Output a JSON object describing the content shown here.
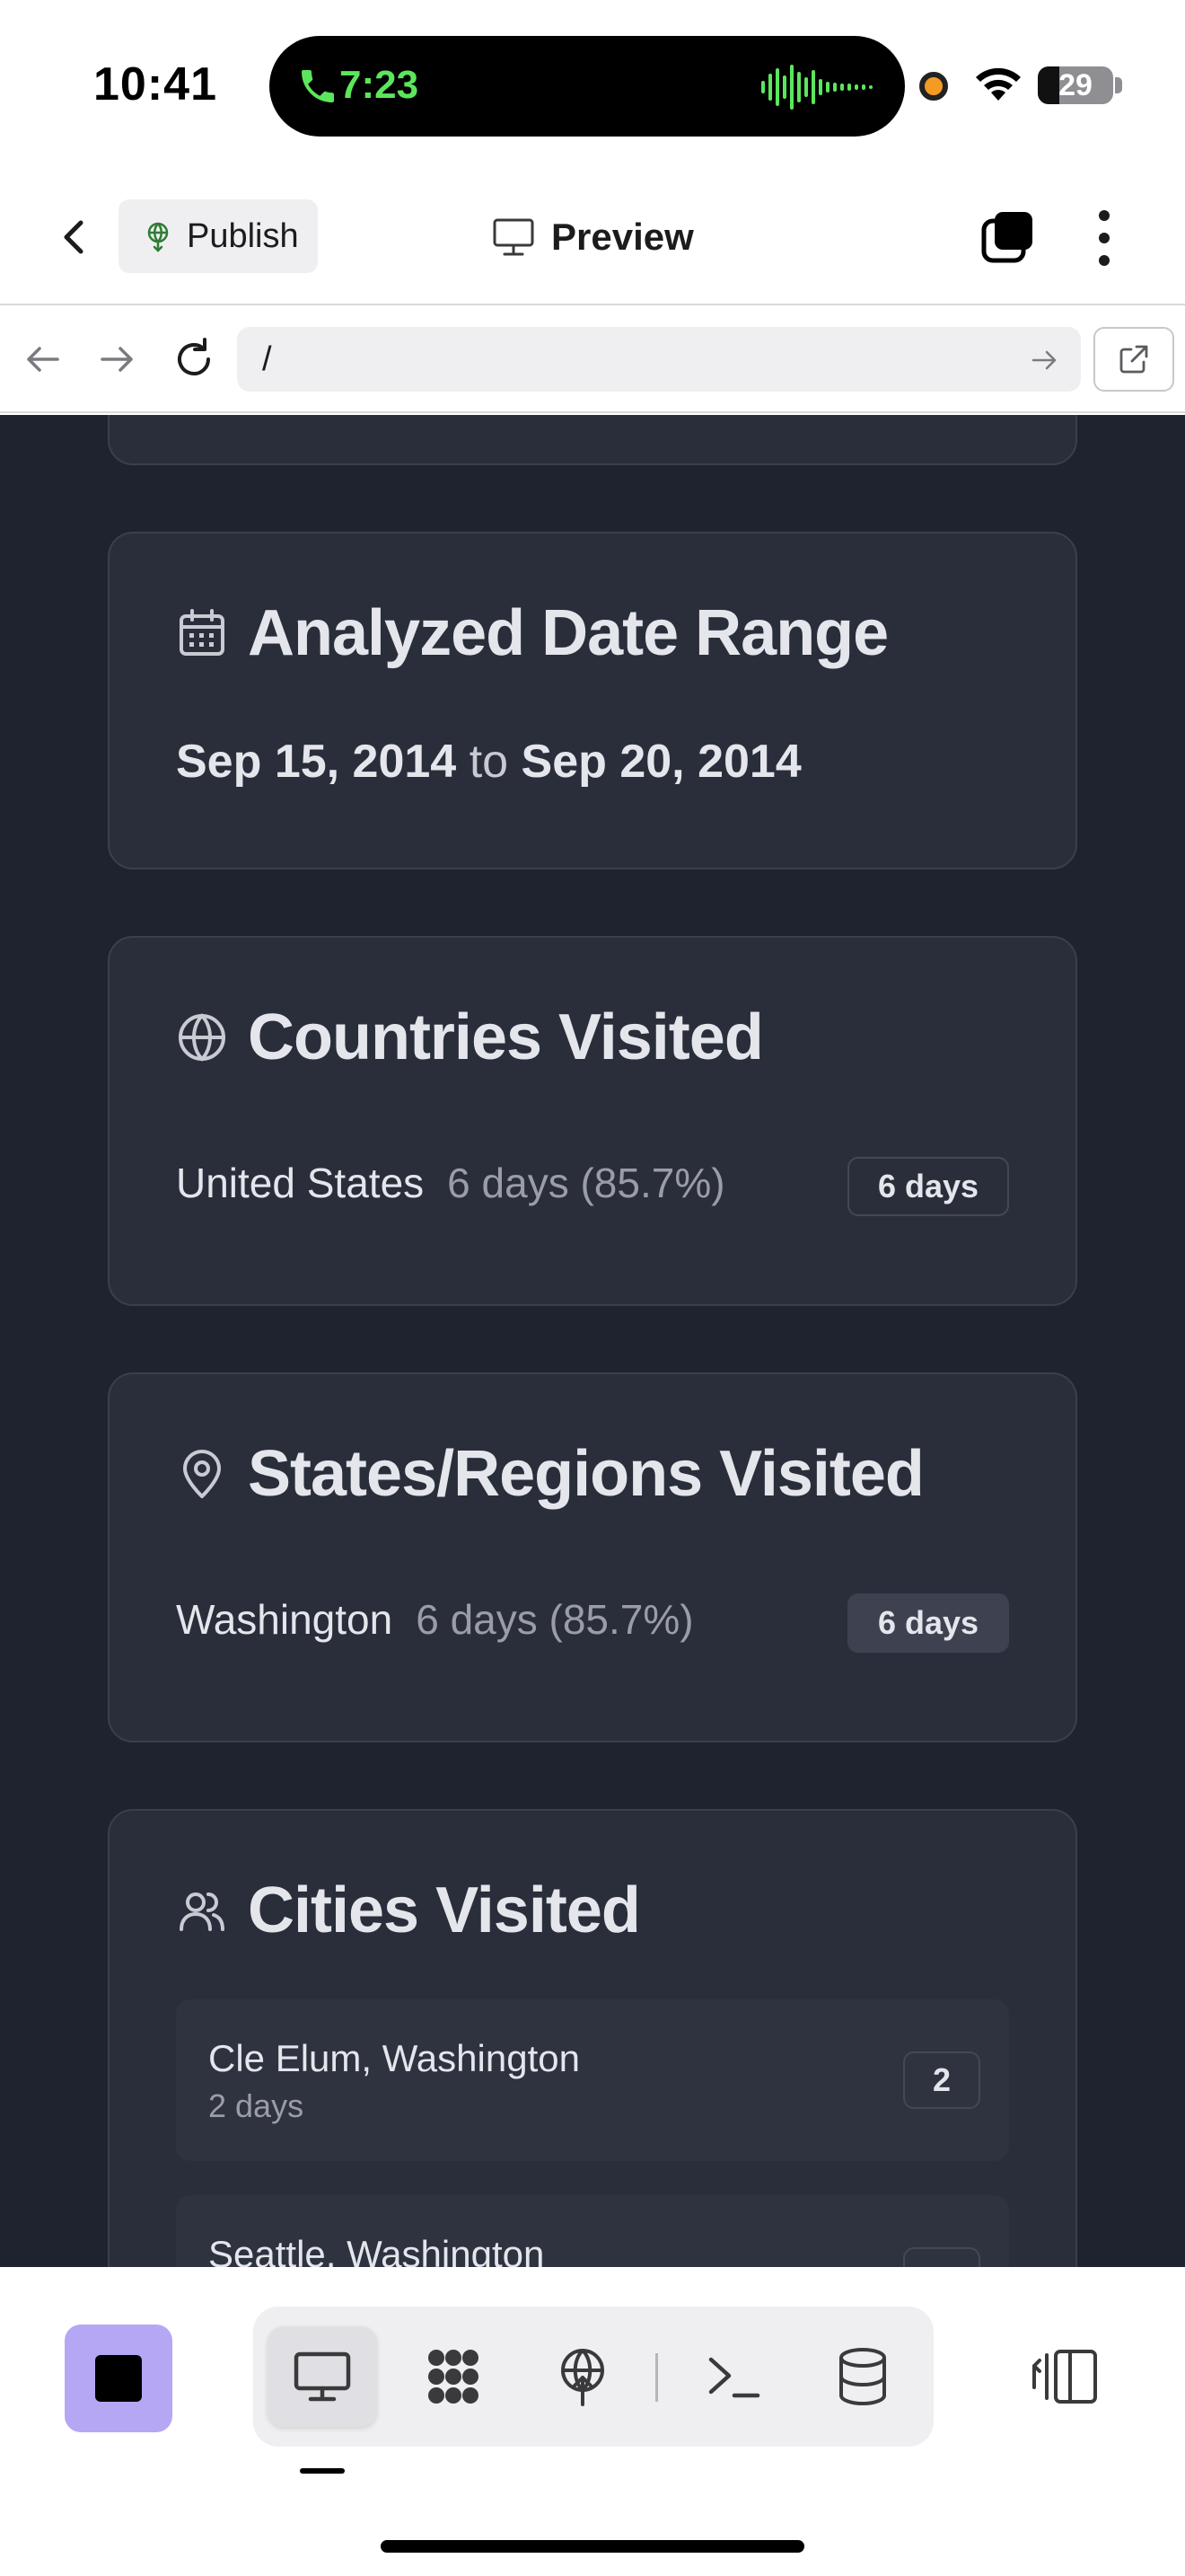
{
  "status_bar": {
    "time": "10:41",
    "call_timer": "7:23",
    "battery_level": "29",
    "battery_fraction": 0.29
  },
  "header": {
    "publish_label": "Publish",
    "preview_label": "Preview"
  },
  "browser": {
    "url_value": "/"
  },
  "date_range": {
    "title": "Analyzed Date Range",
    "start": "Sep 15, 2014",
    "connector": "to",
    "end": "Sep 20, 2014"
  },
  "countries": {
    "title": "Countries Visited",
    "items": [
      {
        "name": "United States",
        "detail": "6 days (85.7%)",
        "badge": "6 days"
      }
    ]
  },
  "regions": {
    "title": "States/Regions Visited",
    "items": [
      {
        "name": "Washington",
        "detail": "6 days (85.7%)",
        "badge": "6 days"
      }
    ]
  },
  "cities": {
    "title": "Cities Visited",
    "items": [
      {
        "name": "Cle Elum, Washington",
        "days": "2 days",
        "count": "2"
      },
      {
        "name": "Seattle, Washington",
        "days": "",
        "count": ""
      }
    ]
  },
  "colors": {
    "content_background": "#1f2330",
    "card_background": "#2a2e3b",
    "stop_button": "#b6a7f5",
    "call_green": "#5ce65c"
  },
  "icons": {
    "header": [
      "back-chevron-icon",
      "publish-icon",
      "monitor-icon",
      "tabs-icon",
      "more-vertical-icon"
    ],
    "browser": [
      "arrow-left-icon",
      "arrow-right-icon",
      "reload-icon",
      "go-arrow-icon",
      "external-link-icon"
    ],
    "cards": [
      "calendar-icon",
      "globe-icon",
      "map-pin-icon",
      "users-icon"
    ],
    "toolbar": [
      "stop-icon",
      "desktop-icon",
      "modules-icon",
      "deploy-icon",
      "terminal-icon",
      "database-icon",
      "side-panel-icon"
    ]
  }
}
